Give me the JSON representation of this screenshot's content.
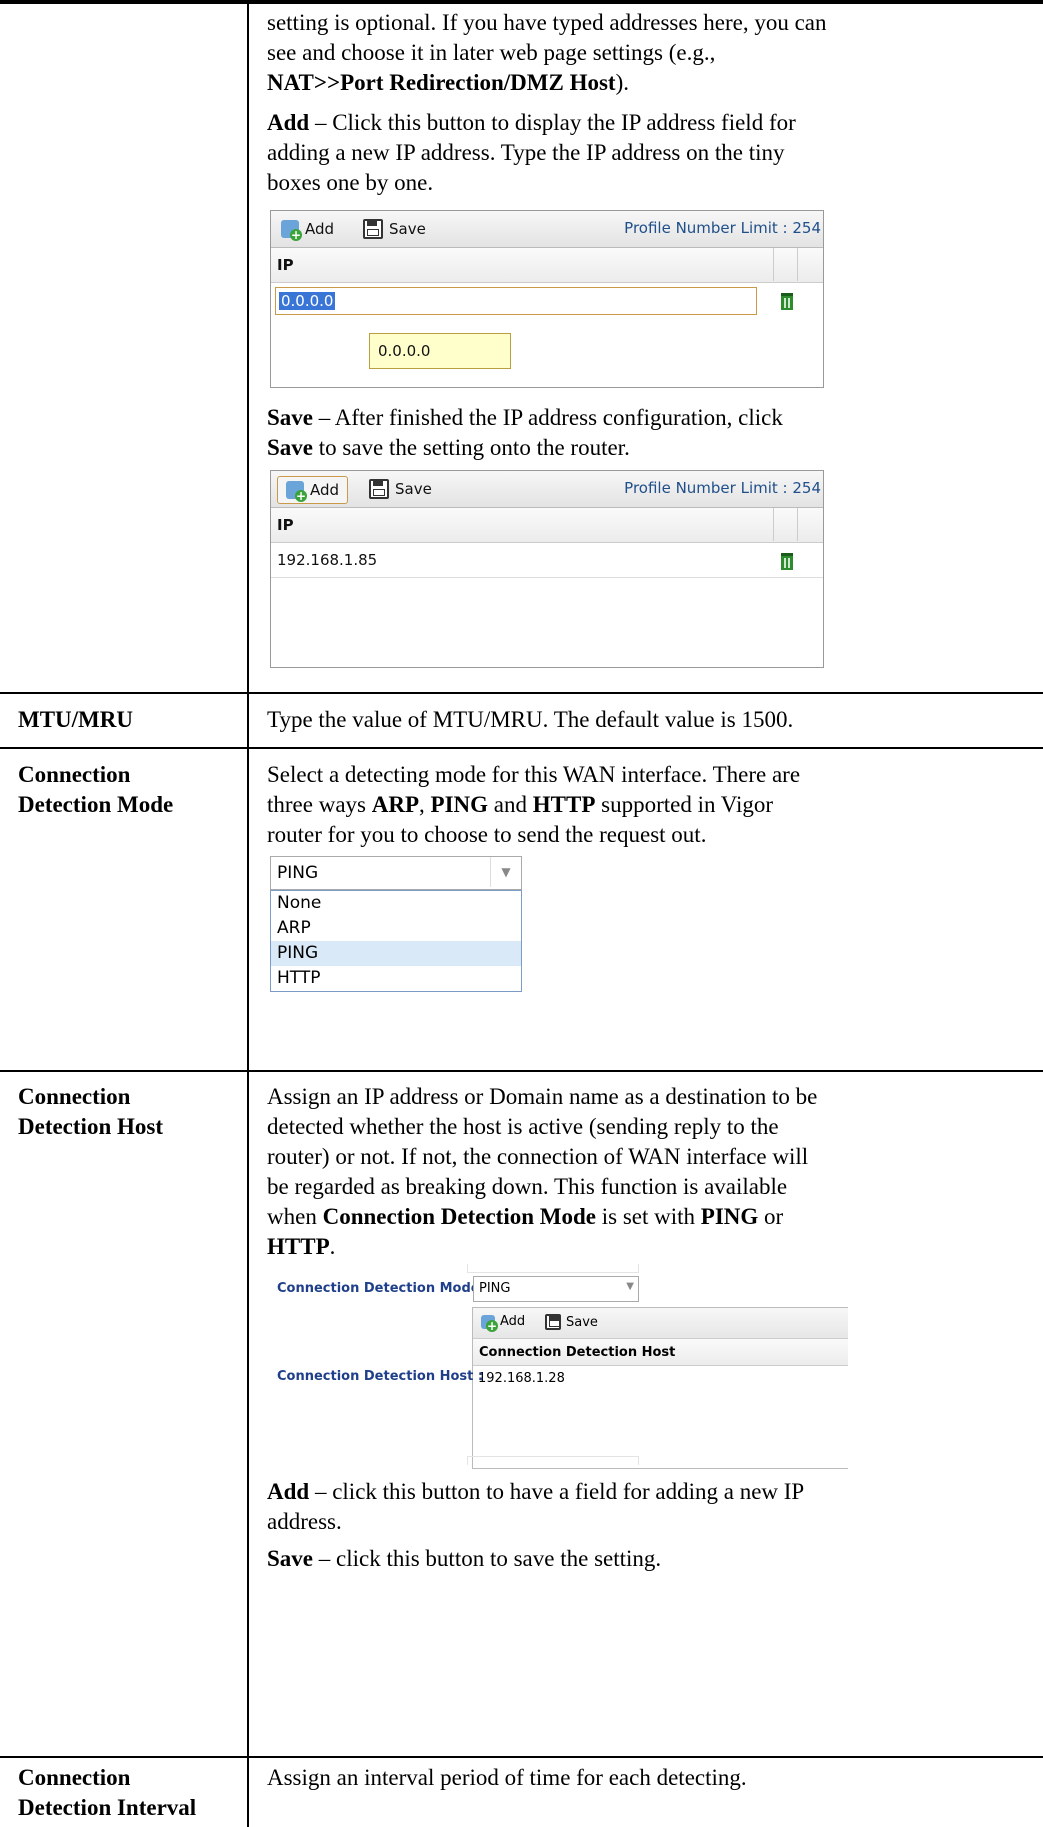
{
  "intro": {
    "line1": "setting is optional. If you have typed addresses here, you can",
    "line2": "see and choose it in later web page settings (e.g.,",
    "line3_bold": "NAT>>Port Redirection/DMZ Host",
    "line3_after": ")."
  },
  "add_desc": {
    "bold": "Add",
    "text1": " – Click this button to display the IP address field for",
    "text2": "adding a new IP address. Type the IP address on the tiny",
    "text3": "boxes one by one."
  },
  "panel1": {
    "add_label": "Add",
    "save_label": "Save",
    "limit_label": "Profile Number Limit : 254",
    "column_header": "IP",
    "input_value": "0.0.0.0",
    "tooltip_value": "0.0.0.0"
  },
  "save_desc": {
    "bold": "Save",
    "text1": " – After finished the IP address configuration, click",
    "bold2": "Save",
    "text2": " to save the setting onto the router."
  },
  "panel2": {
    "add_label": "Add",
    "save_label": "Save",
    "limit_label": "Profile Number Limit : 254",
    "column_header": "IP",
    "row_value": "192.168.1.85"
  },
  "mtu": {
    "label": "MTU/MRU",
    "text": "Type the value of MTU/MRU. The default value is 1500."
  },
  "cdm": {
    "label1": "Connection",
    "label2": "Detection Mode",
    "line1": "Select a detecting mode for this WAN interface. There are",
    "line2_a": "three ways ",
    "line2_arp": "ARP",
    "line2_b": ", ",
    "line2_ping": "PING",
    "line2_c": " and ",
    "line2_http": "HTTP",
    "line2_d": " supported in Vigor",
    "line3": "router for you to choose to send the request out.",
    "dropdown_selected": "PING",
    "options": [
      "None",
      "ARP",
      "PING",
      "HTTP"
    ]
  },
  "cdh": {
    "label1": "Connection",
    "label2": "Detection Host",
    "line1": "Assign an IP address or Domain name as a destination to be",
    "line2": "detected whether the host is active (sending reply to the",
    "line3": "router) or not. If not, the connection of WAN interface will",
    "line4": "be regarded as breaking down. This function is available",
    "line5_a": "when ",
    "line5_bold": "Connection Detection Mode",
    "line5_b": " is set with ",
    "line5_ping": "PING",
    "line5_c": " or",
    "line6_bold": "HTTP",
    "line6_after": ".",
    "ui_mode_label": "Connection Detection Mode :",
    "ui_mode_value": "PING",
    "ui_add": "Add",
    "ui_save": "Save",
    "ui_col_header": "Connection Detection Host",
    "ui_host_label": "Connection Detection Host :",
    "ui_host_value": "192.168.1.28",
    "add_bold": "Add",
    "add_text1": " – click this button to have a field for adding a new IP",
    "add_text2": "address.",
    "save_bold": "Save",
    "save_text": " – click this button to save the setting."
  },
  "cdi": {
    "label1": "Connection",
    "label2": "Detection Interval",
    "text": "Assign an interval period of time for each detecting."
  }
}
